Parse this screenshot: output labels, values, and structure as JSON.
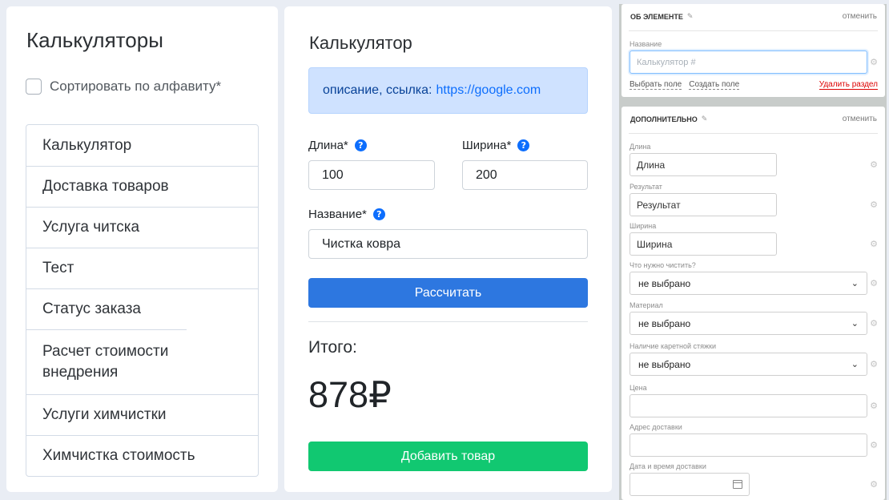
{
  "calculators_panel": {
    "title": "Калькуляторы",
    "sort_label": "Сортировать по алфавиту*",
    "items": [
      "Калькулятор",
      "Доставка товаров",
      "Услуга читска",
      "Тест",
      "Статус заказа",
      "Расчет стоимости внедрения",
      "Услуги химчистки",
      "Химчистка стоимость"
    ]
  },
  "calculator": {
    "title": "Калькулятор",
    "info_text": "описание, ссылка:",
    "info_link": "https://google.com",
    "length_label": "Длина*",
    "length_value": "100",
    "width_label": "Ширина*",
    "width_value": "200",
    "name_label": "Название*",
    "name_value": "Чистка ковра",
    "calculate_button": "Рассчитать",
    "total_label": "Итого:",
    "total_value": "878₽",
    "add_button": "Добавить товар"
  },
  "element_card": {
    "title": "Об элементе",
    "cancel": "отменить",
    "name_label": "Название",
    "name_placeholder": "Калькулятор #",
    "select_field": "Выбрать поле",
    "create_field": "Создать поле",
    "delete_section": "Удалить раздел"
  },
  "extra_card": {
    "title": "Дополнительно",
    "cancel": "отменить",
    "fields": {
      "length_label": "Длина",
      "length_value": "Длина",
      "result_label": "Результат",
      "result_value": "Результат",
      "width_label": "Ширина",
      "width_value": "Ширина",
      "clean_label": "Что нужно чистить?",
      "clean_value": "не выбрано",
      "material_label": "Материал",
      "material_value": "не выбрано",
      "carriage_label": "Наличие каретной стяжки",
      "carriage_value": "не выбрано",
      "price_label": "Цена",
      "address_label": "Адрес доставки",
      "datetime_label": "Дата и время доставки"
    }
  },
  "icons": {
    "help": "help-circle-icon",
    "gear": "gear-icon",
    "pencil": "pencil-icon",
    "chevron": "chevron-down-icon",
    "calendar": "calendar-icon"
  },
  "colors": {
    "primary_button": "#2d77e0",
    "success_button": "#11c871",
    "info_bg": "#cfe2ff",
    "delete_link": "#dd0000"
  }
}
